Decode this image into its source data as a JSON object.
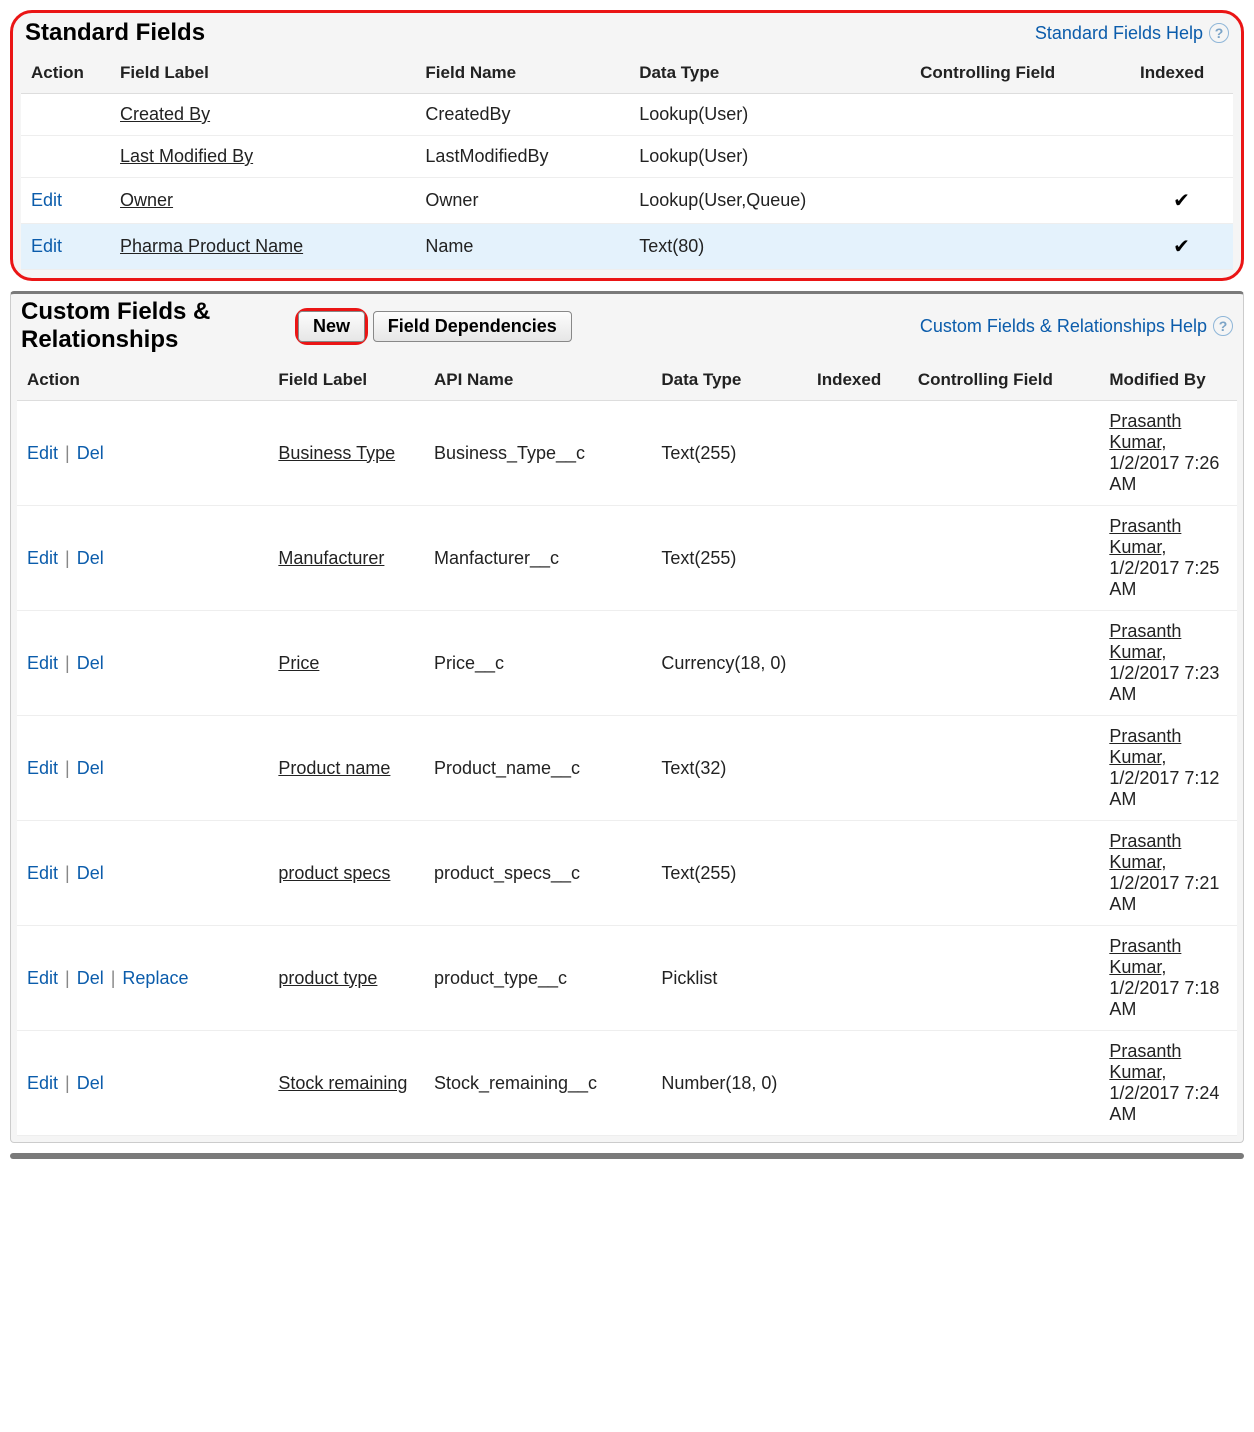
{
  "standard": {
    "title": "Standard Fields",
    "help": "Standard Fields Help",
    "headers": {
      "action": "Action",
      "label": "Field Label",
      "name": "Field Name",
      "type": "Data Type",
      "controlling": "Controlling Field",
      "indexed": "Indexed"
    },
    "rows": [
      {
        "actions": [],
        "label": "Created By",
        "name": "CreatedBy",
        "type": "Lookup(User)",
        "controlling": "",
        "indexed": false,
        "highlight": false
      },
      {
        "actions": [],
        "label": "Last Modified By",
        "name": "LastModifiedBy",
        "type": "Lookup(User)",
        "controlling": "",
        "indexed": false,
        "highlight": false
      },
      {
        "actions": [
          "Edit"
        ],
        "label": "Owner",
        "name": "Owner",
        "type": "Lookup(User,Queue)",
        "controlling": "",
        "indexed": true,
        "highlight": false
      },
      {
        "actions": [
          "Edit"
        ],
        "label": "Pharma Product Name",
        "name": "Name",
        "type": "Text(80)",
        "controlling": "",
        "indexed": true,
        "highlight": true
      }
    ]
  },
  "custom": {
    "title": "Custom Fields & Relationships",
    "buttons": {
      "new": "New",
      "deps": "Field Dependencies"
    },
    "help": "Custom Fields & Relationships Help",
    "headers": {
      "action": "Action",
      "label": "Field Label",
      "api": "API Name",
      "type": "Data Type",
      "indexed": "Indexed",
      "controlling": "Controlling Field",
      "modified": "Modified By"
    },
    "rows": [
      {
        "actions": [
          "Edit",
          "Del"
        ],
        "label": "Business Type",
        "api": "Business_Type__c",
        "type": "Text(255)",
        "indexed": "",
        "controlling": "",
        "modified_by": "Prasanth Kumar",
        "modified_at": "1/2/2017 7:26 AM"
      },
      {
        "actions": [
          "Edit",
          "Del"
        ],
        "label": "Manufacturer",
        "api": "Manfacturer__c",
        "type": "Text(255)",
        "indexed": "",
        "controlling": "",
        "modified_by": "Prasanth Kumar",
        "modified_at": "1/2/2017 7:25 AM"
      },
      {
        "actions": [
          "Edit",
          "Del"
        ],
        "label": "Price",
        "api": "Price__c",
        "type": "Currency(18, 0)",
        "indexed": "",
        "controlling": "",
        "modified_by": "Prasanth Kumar",
        "modified_at": "1/2/2017 7:23 AM"
      },
      {
        "actions": [
          "Edit",
          "Del"
        ],
        "label": "Product name",
        "api": "Product_name__c",
        "type": "Text(32)",
        "indexed": "",
        "controlling": "",
        "modified_by": "Prasanth Kumar",
        "modified_at": "1/2/2017 7:12 AM"
      },
      {
        "actions": [
          "Edit",
          "Del"
        ],
        "label": "product specs",
        "api": "product_specs__c",
        "type": "Text(255)",
        "indexed": "",
        "controlling": "",
        "modified_by": "Prasanth Kumar",
        "modified_at": "1/2/2017 7:21 AM"
      },
      {
        "actions": [
          "Edit",
          "Del",
          "Replace"
        ],
        "label": "product type",
        "api": "product_type__c",
        "type": "Picklist",
        "indexed": "",
        "controlling": "",
        "modified_by": "Prasanth Kumar",
        "modified_at": "1/2/2017 7:18 AM"
      },
      {
        "actions": [
          "Edit",
          "Del"
        ],
        "label": "Stock remaining",
        "api": "Stock_remaining__c",
        "type": "Number(18, 0)",
        "indexed": "",
        "controlling": "",
        "modified_by": "Prasanth Kumar",
        "modified_at": "1/2/2017 7:24 AM"
      }
    ]
  }
}
